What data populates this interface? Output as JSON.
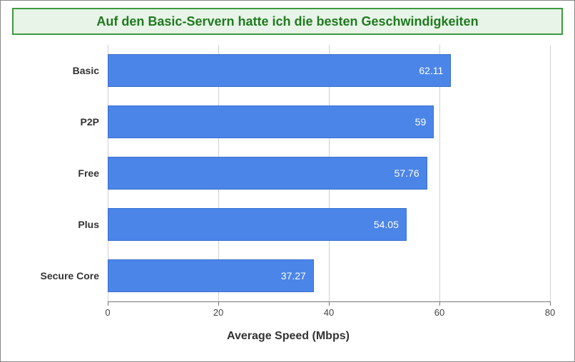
{
  "title": "Auf den Basic-Servern hatte ich die besten Geschwindigkeiten",
  "colors": {
    "title_border": "#3b9b3b",
    "title_bg": "#e8f4e8",
    "title_text": "#1f7a1f",
    "bar_fill": "#4b85e8",
    "bar_border": "#3a6fd0"
  },
  "chart_data": {
    "type": "bar",
    "orientation": "horizontal",
    "categories": [
      "Basic",
      "P2P",
      "Free",
      "Plus",
      "Secure Core"
    ],
    "values": [
      62.11,
      59,
      57.76,
      54.05,
      37.27
    ],
    "value_labels": [
      "62.11",
      "59",
      "57.76",
      "54.05",
      "37.27"
    ],
    "xlabel": "Average Speed (Mbps)",
    "ylabel": "",
    "xlim": [
      0,
      80
    ],
    "xticks": [
      0,
      20,
      40,
      60,
      80
    ],
    "xtick_labels": [
      "0",
      "20",
      "40",
      "60",
      "80"
    ]
  }
}
